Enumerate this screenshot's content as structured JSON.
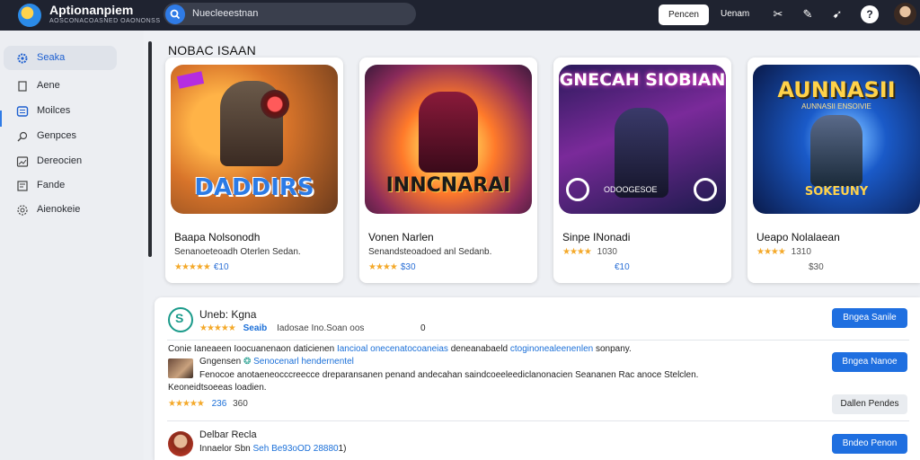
{
  "topbar": {
    "brand": "Aptionanpiem",
    "brand_sub": "AOSCONACOASNED OAONONSS",
    "search_text": "Nuecleeestnan",
    "button_label": "Pencen",
    "link_label": "Uenam",
    "help_label": "?"
  },
  "sidebar": {
    "items": [
      {
        "label": "Seaka",
        "icon": "gear-icon"
      },
      {
        "label": "Aene",
        "icon": "bookmark-icon"
      },
      {
        "label": "Moilces",
        "icon": "grid-icon"
      },
      {
        "label": "Genpces",
        "icon": "search-icon"
      },
      {
        "label": "Dereocien",
        "icon": "image-icon"
      },
      {
        "label": "Fande",
        "icon": "list-icon"
      },
      {
        "label": "Aienokeie",
        "icon": "settings-icon"
      }
    ]
  },
  "section_title": "NOBAC ISAAN",
  "cards": [
    {
      "art_title": "DADDIRS",
      "badge": "",
      "name": "Baapa Nolsonodh",
      "desc": "Senanoeteoadh Oterlen Sedan.",
      "stars": "★★★★★",
      "price": "€10"
    },
    {
      "art_title": "INNCNARAI",
      "badge": "",
      "name": "Vonen Narlen",
      "desc": "Senandsteoadoed anl Sedanb.",
      "stars": "★★★★",
      "price": "$30"
    },
    {
      "art_title": "GNECAH SIOBIAN",
      "badge": "",
      "name": "Sinpe INonadi",
      "desc": "",
      "stars": "★★★★",
      "price": "1030"
    },
    {
      "art_title": "AUNNASII",
      "badge": "SOKEUNY",
      "name": "Ueapo Nolalaean",
      "desc": "",
      "stars": "★★★★",
      "price": "1310"
    }
  ],
  "card_extra": {
    "card3_price2": "€10",
    "card3_overlay": "ODOOGESOE",
    "card4_price2": "$30",
    "card4_sub": "AUNNASII ENSOIVIE"
  },
  "list": {
    "row1": {
      "name": "Uneb: Kgna",
      "stars": "★★★★★",
      "link": "Seaib",
      "meta": "Iadosae Ino.Soan oos",
      "count": "0",
      "button": "Bngea Sanile"
    },
    "row2": {
      "line1_a": "Conie Ianeaeen Ioocuanenaon daticienen ",
      "line1_b": "Iancioal onecenatocoaneias",
      "line1_c": " deneanabaeld ",
      "line1_d": "ctoginonealeenenlen",
      "line1_e": " sonpany.",
      "user_label": "Gngensen",
      "user_link": "Senocenarl hendernentel",
      "line3": "Fenocoe anotaeneocccreecce dreparansanen penand andecahan saindcoeeleediclanonacien Seananen Rac anoce Stelclen.",
      "line4": "Keoneidtsoeeas loadien.",
      "stars": "★★★★★",
      "rating": "236",
      "count": "360",
      "button1": "Bngea Nanoe",
      "button2": "Dallen Pendes"
    },
    "row3": {
      "name": "Delbar Recla",
      "meta_a": "Innaelor Sbn ",
      "meta_b": "Seh Be93oOD 28880",
      "meta_c": "1)",
      "button": "Bndeo Penon"
    }
  },
  "colors": {
    "topbar": "#1f2330",
    "accent": "#1f6fe0",
    "star": "#f4a92a",
    "sidebar": "#eceef2"
  }
}
